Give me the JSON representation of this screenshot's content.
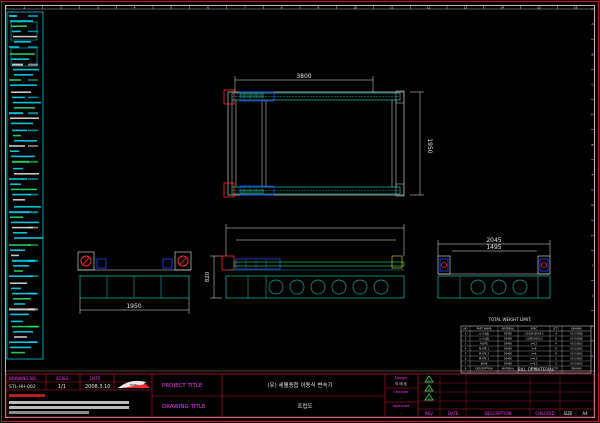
{
  "colors": {
    "background": "#000000",
    "frame": "#e8e8e8",
    "border_red": "#c8102e",
    "cyan": "#00e5ff",
    "green": "#2ee86b",
    "teal": "#1aa69a",
    "blue": "#2447ff",
    "red": "#ff2a2a",
    "magenta": "#ff33ff",
    "yellow": "#ffd700",
    "white": "#ffffff",
    "gray": "#b0b0b0"
  },
  "grid_labels": {
    "top": [
      "1",
      "2",
      "3",
      "4",
      "5",
      "6",
      "7",
      "8",
      "9",
      "10",
      "11",
      "12",
      "13",
      "14",
      "15",
      "16"
    ],
    "side": [
      "A",
      "B",
      "C",
      "D",
      "E",
      "F",
      "G",
      "H",
      "I",
      "J",
      "K",
      "L"
    ]
  },
  "dimensions": {
    "top_width": "3800",
    "top_height": "1950",
    "front_width": "1950",
    "front_height": "820",
    "side_outer": "2045",
    "side_inner": "1495"
  },
  "parts_table": {
    "title": "TOTAL WEIGHT LIMIT:",
    "headers": [
      "NO",
      "PART NAME",
      "MATERIAL",
      "SPEC",
      "Q'TY",
      "REMARK"
    ],
    "rows": [
      [
        "1",
        "ㅁ-프레임",
        "SS400",
        "□100X100X4.5",
        "4",
        "KS D3568"
      ],
      [
        "2",
        "ㅁ-프레임",
        "SS400",
        "□100X50X3.2",
        "8",
        "KS D3568"
      ],
      [
        "3",
        "PLATE",
        "SS400",
        "t=12",
        "4",
        "KS D3503"
      ],
      [
        "4",
        "PLATE 1",
        "SS400",
        "t=9",
        "8",
        "KS D3503"
      ],
      [
        "5",
        "PLATE 2",
        "SS400",
        "t=6",
        "6",
        "KS D3503"
      ],
      [
        "6",
        "PLATE 3",
        "SS400",
        "t=4.5",
        "2",
        "KS D3503"
      ],
      [
        "7",
        "BASE",
        "SS400",
        "t=3.2",
        "2",
        "KS D3503"
      ],
      [
        "8",
        "DESCRIPTION",
        "MATERIAL",
        "SPEC",
        "QTY",
        "REMARK"
      ]
    ],
    "footer": "BILL OF MATERIAL"
  },
  "title_block": {
    "drawing_no_label": "DRAWING NO.",
    "drawing_no": "STL-HH-002",
    "scale_label": "SCALE",
    "scale": "1/1",
    "date_label": "DATE",
    "date": "2008.3.10",
    "project_title_label": "PROJECT TITLE",
    "project_title": "(유) 세웰종합 이동식 변속기",
    "drawing_title_label": "DRAWING TITLE",
    "drawing_title": "조립도",
    "design_label": "Design",
    "design_value": "이 태 호",
    "checked_label": "Checked",
    "checked_value": "-",
    "approved_label": "Approved",
    "approved_value": "-",
    "rev_label": "REV",
    "date_col_label": "DATE",
    "description_label": "DESCRIPTION",
    "checked_col_label": "CHECKED",
    "sheet_label": "SIZE",
    "sheet_size": "A4",
    "company_name": "HANA",
    "rev_marks": [
      "1",
      "2",
      "3"
    ]
  },
  "left_panel": {
    "item_count": 64
  }
}
